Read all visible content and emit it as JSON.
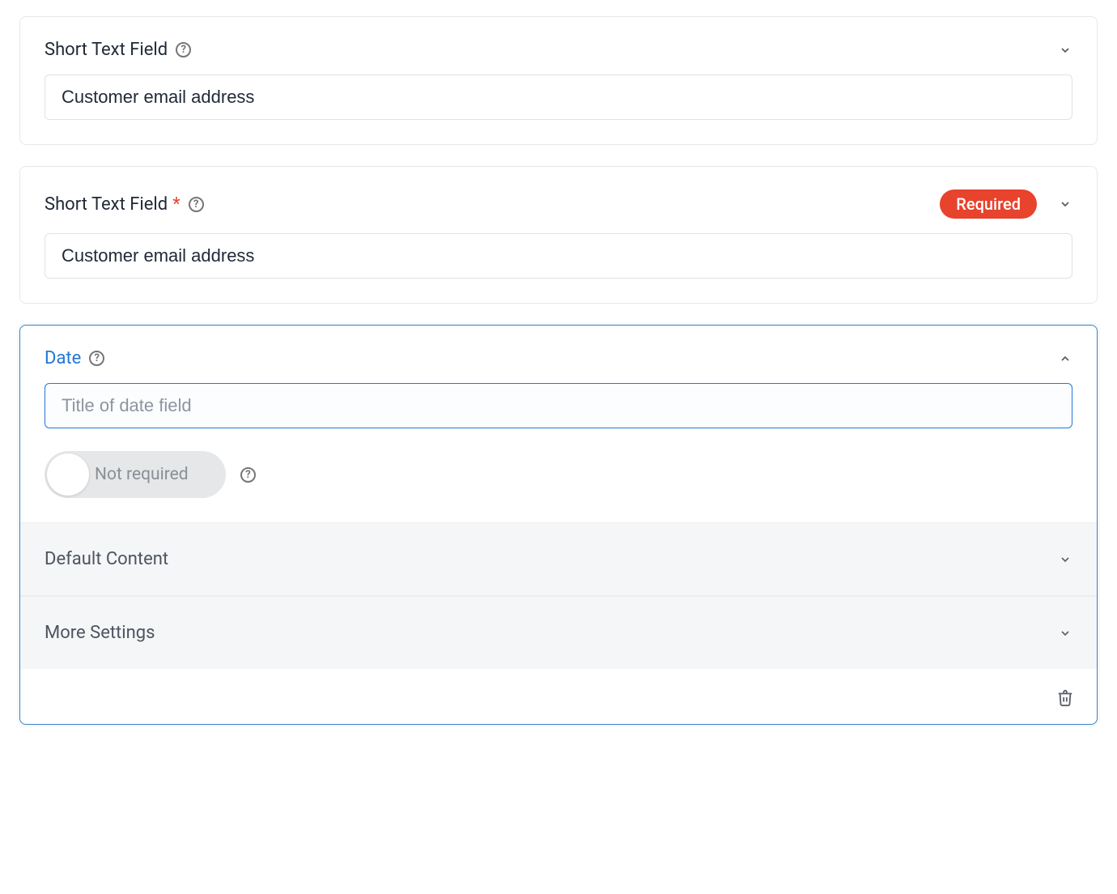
{
  "fields": [
    {
      "label": "Short Text Field",
      "value": "Customer email address",
      "required": false
    },
    {
      "label": "Short Text Field",
      "value": "Customer email address",
      "required": true,
      "required_badge": "Required"
    }
  ],
  "active_field": {
    "label": "Date",
    "placeholder": "Title of date field",
    "toggle_label": "Not required",
    "sections": {
      "default_content": "Default Content",
      "more_settings": "More Settings"
    }
  }
}
